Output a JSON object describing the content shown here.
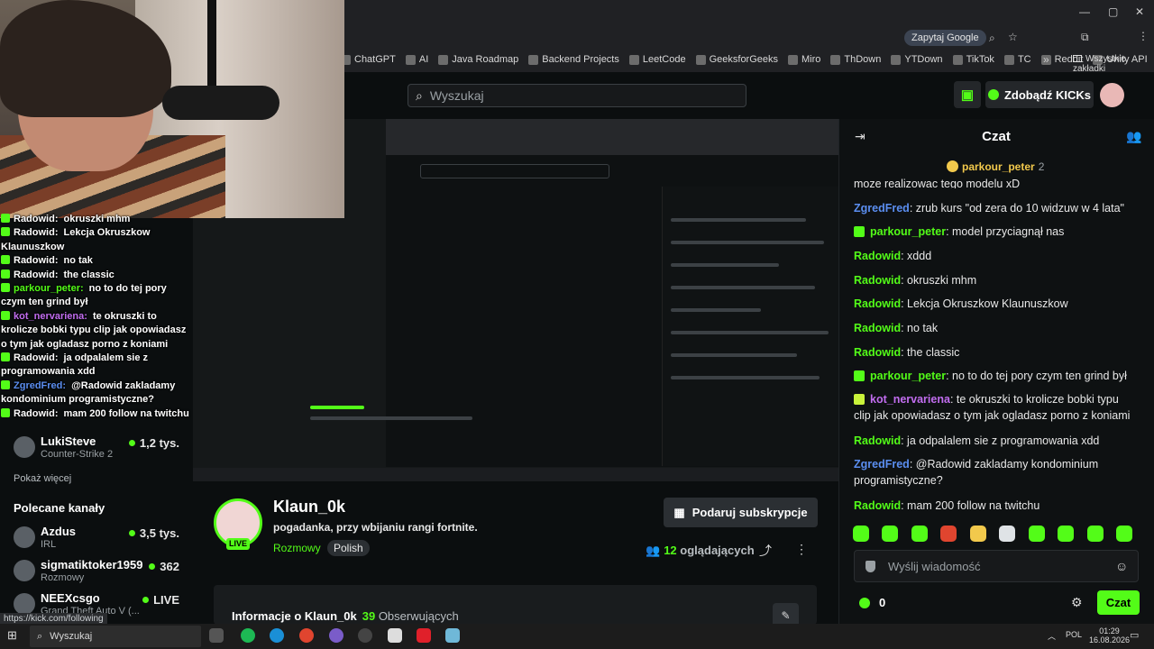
{
  "browser": {
    "ask_google": "Zapytaj Google",
    "bookmarks": [
      "ChatGPT",
      "AI",
      "Java Roadmap",
      "Backend Projects",
      "LeetCode",
      "GeeksforGeeks",
      "Miro",
      "ThDown",
      "YTDown",
      "TikTok",
      "TC",
      "Reddit",
      "Unity API"
    ],
    "all_bookmarks": "Wszystkie zakładki",
    "status_url": "https://kick.com/following"
  },
  "header": {
    "search_placeholder": "Wyszukaj",
    "kicks_label": "Zdobądź KICKs"
  },
  "overlay_chat": [
    {
      "user": "Radowid:",
      "text": "okruszki mhm"
    },
    {
      "user": "Radowid:",
      "text": "Lekcja Okruszkow Klaunuszkow"
    },
    {
      "user": "Radowid:",
      "text": "no tak"
    },
    {
      "user": "Radowid:",
      "text": "the classic"
    },
    {
      "user": "parkour_peter:",
      "text": "no to do tej pory czym ten grind był"
    },
    {
      "user": "kot_nervariena:",
      "text": "te okruszki to krolicze bobki typu clip jak opowiadasz o tym jak ogladasz porno z koniami"
    },
    {
      "user": "Radowid:",
      "text": "ja odpalalem sie z programowania xdd"
    },
    {
      "user": "ZgredFred:",
      "text": "@Radowid zakladamy kondominium programistyczne?"
    },
    {
      "user": "Radowid:",
      "text": "mam 200 follow na twitchu"
    }
  ],
  "sidebar": {
    "followed": [
      {
        "name": "LukiSteve",
        "category": "Counter-Strike 2",
        "viewers": "1,2 tys."
      }
    ],
    "show_more": "Pokaż więcej",
    "recommended_title": "Polecane kanały",
    "recommended": [
      {
        "name": "Azdus",
        "category": "IRL",
        "viewers": "3,5 tys."
      },
      {
        "name": "sigmatiktoker1959",
        "category": "Rozmowy",
        "viewers": "362"
      },
      {
        "name": "NEEXcsgo",
        "category": "Grand Theft Auto V (...",
        "viewers": "LIVE"
      }
    ]
  },
  "channel": {
    "name": "Klaun_0k",
    "live": "LIVE",
    "title": "pogadanka, przy wbijaniu rangi fortnite.",
    "category": "Rozmowy",
    "tag": "Polish",
    "gift_label": "Podaruj subskrypcje",
    "viewers_count": "12",
    "viewers_label": "oglądających",
    "info_title": "Informacje o Klaun_0k",
    "followers_count": "39",
    "followers_label": "Obserwujących"
  },
  "chat": {
    "title": "Czat",
    "pinned_user": "parkour_peter",
    "pinned_count": "2",
    "partial_top": "moze realizowac tego modelu xD",
    "messages": [
      {
        "user": "ZgredFred",
        "text": "zrub kurs \"od zera do 10 widzuw w 4 lata\"",
        "color": "#5b8ef0",
        "badge": false
      },
      {
        "user": "parkour_peter",
        "text": "model przyciagnął nas",
        "color": "#53fc18",
        "badge": true
      },
      {
        "user": "Radowid",
        "text": "xddd",
        "color": "#53fc18",
        "badge": false
      },
      {
        "user": "Radowid",
        "text": "okruszki mhm",
        "color": "#53fc18",
        "badge": false
      },
      {
        "user": "Radowid",
        "text": "Lekcja Okruszkow Klaunuszkow",
        "color": "#53fc18",
        "badge": false
      },
      {
        "user": "Radowid",
        "text": "no tak",
        "color": "#53fc18",
        "badge": false
      },
      {
        "user": "Radowid",
        "text": "the classic",
        "color": "#53fc18",
        "badge": false
      },
      {
        "user": "parkour_peter",
        "text": "no to do tej pory czym ten grind był",
        "color": "#53fc18",
        "badge": true
      },
      {
        "user": "kot_nervariena",
        "text": "te okruszki to krolicze bobki typu clip jak opowiadasz o tym jak ogladasz porno z koniami",
        "color": "#c26df0",
        "badge": true
      },
      {
        "user": "Radowid",
        "text": "ja odpalalem sie z programowania xdd",
        "color": "#53fc18",
        "badge": false
      },
      {
        "user": "ZgredFred",
        "text": "@Radowid zakladamy kondominium programistyczne?",
        "color": "#5b8ef0",
        "badge": false
      },
      {
        "user": "Radowid",
        "text": "mam 200 follow na twitchu",
        "color": "#53fc18",
        "badge": false
      }
    ],
    "input_placeholder": "Wyślij wiadomość",
    "points": "0",
    "send_label": "Czat"
  },
  "taskbar": {
    "search": "Wyszukaj",
    "lang": "POL",
    "time": "01:29",
    "date": "16.08.2026"
  },
  "colors": {
    "accent": "#53fc18",
    "background": "#0b0e0f"
  }
}
